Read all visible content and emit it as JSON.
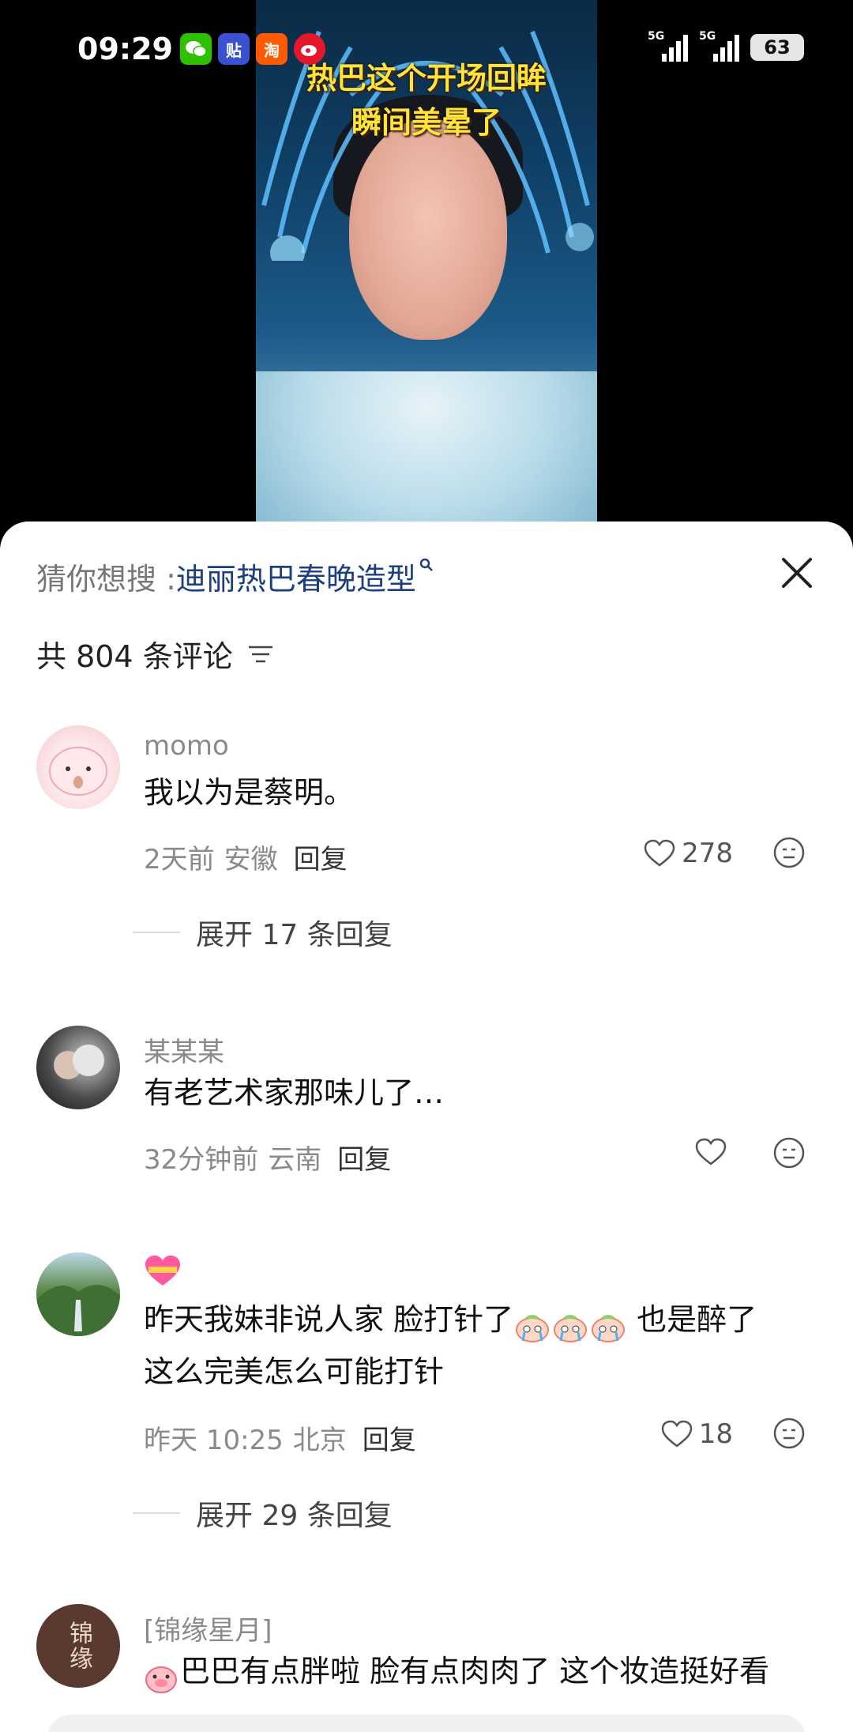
{
  "status_bar": {
    "time": "09:29",
    "app_icons": [
      "wechat-icon",
      "tieba-icon",
      "taobao-icon",
      "weibo-icon"
    ],
    "signal1_label": "5G",
    "signal2_label": "5G",
    "battery": "63"
  },
  "video": {
    "caption_line1": "热巴这个开场回眸",
    "caption_line2": "瞬间美晕了"
  },
  "sheet": {
    "suggest_prefix": "猜你想搜 : ",
    "suggest_keyword": "迪丽热巴春晚造型",
    "comment_count": "共 804 条评论"
  },
  "comments": [
    {
      "name": "momo",
      "text": "我以为是蔡明。",
      "time": "2天前",
      "location": "安徽",
      "reply": "回复",
      "likes": "278",
      "expand": "展开 17 条回复"
    },
    {
      "name": "某某某",
      "text": "有老艺术家那味儿了…",
      "time": "32分钟前",
      "location": "云南",
      "reply": "回复",
      "likes": ""
    },
    {
      "name": "",
      "text_part1": "昨天我妹非说人家 脸打针了",
      "text_part2": " 也是醉了",
      "text_line2": "这么完美怎么可能打针",
      "time": "昨天 10:25",
      "location": "北京",
      "reply": "回复",
      "likes": "18",
      "expand": "展开 29 条回复"
    },
    {
      "name": "[锦缘星月]",
      "avatar_text": "锦缘",
      "text": "巴巴有点胖啦 脸有点肉肉了 这个妆造挺好看"
    }
  ],
  "colors": {
    "keyword": "#1d3f7d",
    "caption": "#ffe23a"
  }
}
